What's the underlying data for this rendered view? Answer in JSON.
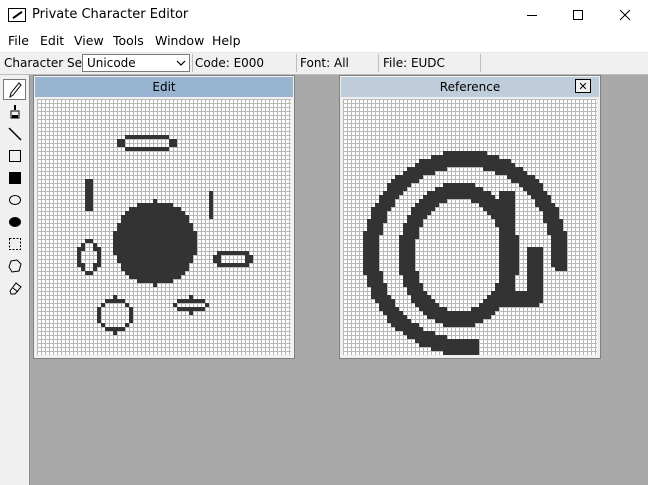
{
  "window": {
    "title": "Private Character Editor"
  },
  "menu": [
    {
      "label": "File"
    },
    {
      "label": "Edit"
    },
    {
      "label": "View"
    },
    {
      "label": "Tools"
    },
    {
      "label": "Window"
    },
    {
      "label": "Help"
    }
  ],
  "info": {
    "character_set_label": "Character Set:",
    "character_set_value": "Unicode",
    "code": "Code: E000",
    "font": "Font: All",
    "file": "File: EUDC"
  },
  "tools": [
    {
      "name": "pencil-tool-icon",
      "active": true
    },
    {
      "name": "brush-tool-icon"
    },
    {
      "name": "line-tool-icon"
    },
    {
      "name": "hollow-rectangle-tool-icon"
    },
    {
      "name": "filled-rectangle-tool-icon"
    },
    {
      "name": "hollow-ellipse-tool-icon"
    },
    {
      "name": "filled-ellipse-tool-icon"
    },
    {
      "name": "rectangular-selection-tool-icon"
    },
    {
      "name": "freeform-selection-tool-icon"
    },
    {
      "name": "eraser-tool-icon"
    }
  ],
  "edit_panel": {
    "title": "Edit",
    "header_color": "#99b4d1"
  },
  "reference_panel": {
    "title": "Reference",
    "header_color": "#bfcddb",
    "close": "✕"
  },
  "colors": {
    "background": "#a9a9a9",
    "pixel_on": "#333333",
    "grid_line": "#b8b8b8"
  }
}
